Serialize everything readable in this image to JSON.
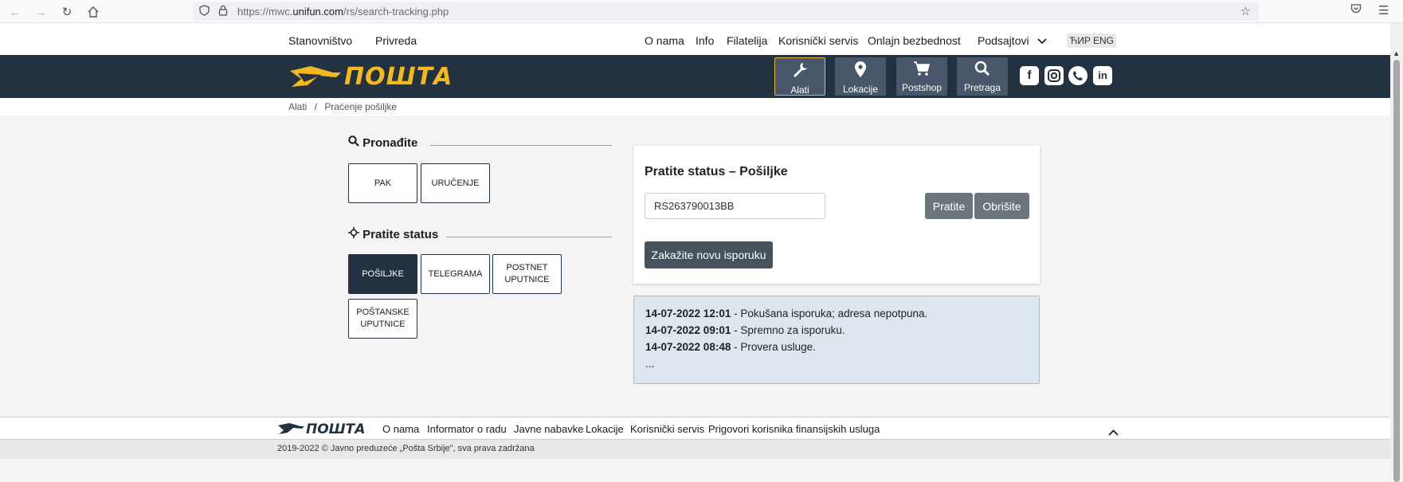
{
  "browser": {
    "url_prefix": "https://mwc.",
    "url_domain": "unifun.com",
    "url_path": "/rs/search-tracking.php"
  },
  "top_nav": {
    "left": [
      "Stanovništvo",
      "Privreda"
    ],
    "right": [
      "O nama",
      "Info",
      "Filatelija",
      "Korisnički servis",
      "Onlajn bezbednost",
      "Podsajtovi"
    ],
    "languages": [
      "ЋИР",
      "ENG"
    ]
  },
  "header": {
    "logo_text": "ПОШТА",
    "tools": [
      {
        "label": "Alati",
        "icon": "wrench-icon"
      },
      {
        "label": "Lokacije",
        "icon": "map-pin-icon"
      },
      {
        "label": "Postshop",
        "icon": "cart-icon"
      },
      {
        "label": "Pretraga",
        "icon": "search-icon"
      }
    ],
    "social": [
      "facebook-icon",
      "instagram-icon",
      "viber-icon",
      "linkedin-icon"
    ]
  },
  "breadcrumb": {
    "items": [
      "Alati",
      "Praćenje pošiljke"
    ],
    "separator": "/"
  },
  "find_section": {
    "title": "Pronađite",
    "tiles": [
      "PAK",
      "URUČENJE"
    ]
  },
  "status_section": {
    "title": "Pratite status",
    "tiles": [
      "POŠILJKE",
      "TELEGRAMA",
      "POSTNET UPUTNICE",
      "POŠTANSKE UPUTNICE"
    ]
  },
  "tracking_card": {
    "title": "Pratite status – Pošiljke",
    "tracking_number": "RS263790013BB",
    "track_button": "Pratite",
    "clear_button": "Obrišite",
    "schedule_button": "Zakažite novu isporuku"
  },
  "events": [
    {
      "time": "14-07-2022 12:01",
      "text": " - Pokušana isporuka; adresa nepotpuna."
    },
    {
      "time": "14-07-2022 09:01",
      "text": " - Spremno za isporuku."
    },
    {
      "time": "14-07-2022 08:48",
      "text": " - Provera usluge."
    }
  ],
  "events_more": "...",
  "footer": {
    "logo_text": "ПОШТА",
    "links": [
      "O nama",
      "Informator o radu",
      "Javne nabavke",
      "Lokacije",
      "Korisnički servis",
      "Prigovori korisnika finansijskih usluga"
    ],
    "copyright": "2019-2022 © Javno preduzeće „Pošta Srbije\", sva prava zadržana"
  },
  "colors": {
    "header_bg": "#233240",
    "brand_yellow": "#f5b91b",
    "button_grey": "#6c757d"
  }
}
